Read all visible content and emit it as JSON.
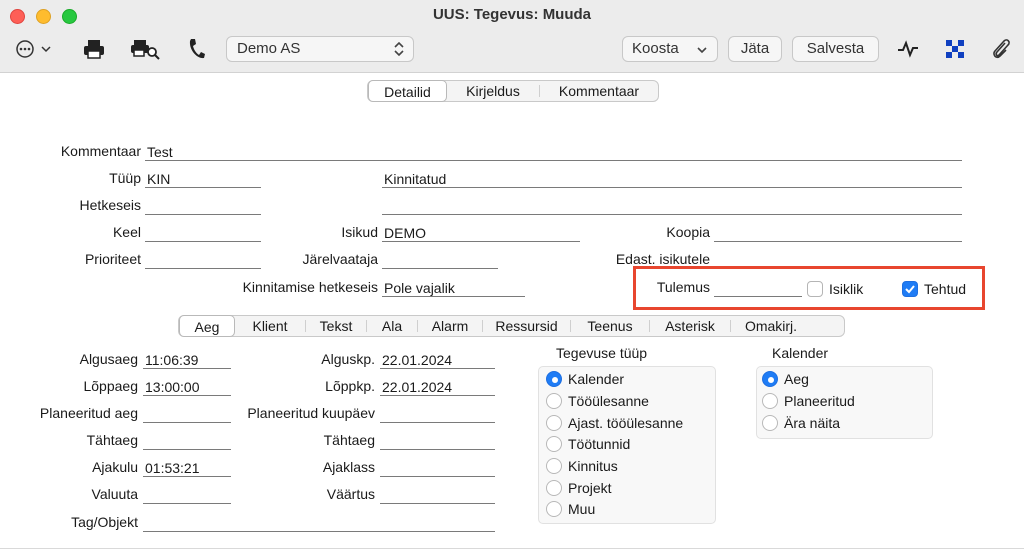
{
  "window": {
    "title": "UUS: Tegevus: Muuda"
  },
  "toolbar": {
    "company": "Demo AS",
    "koosta": "Koosta",
    "jata": "Jäta",
    "salvesta": "Salvesta"
  },
  "top_tabs": [
    "Detailid",
    "Kirjeldus",
    "Kommentaar"
  ],
  "header_fields": {
    "kommentaar_label": "Kommentaar",
    "kommentaar_value": "Test",
    "tyyp_label": "Tüüp",
    "tyyp_value": "KIN",
    "tyyp_desc": "Kinnitatud",
    "hetkeseis_label": "Hetkeseis",
    "hetkeseis_value": "",
    "hetkeseis_desc": "",
    "keel_label": "Keel",
    "keel_value": "",
    "isikud_label": "Isikud",
    "isikud_value": "DEMO",
    "koopia_label": "Koopia",
    "koopia_value": "",
    "prioriteet_label": "Prioriteet",
    "prioriteet_value": "",
    "jarelvaataja_label": "Järelvaataja",
    "jarelvaataja_value": "",
    "edast_label": "Edast. isikutele",
    "kinnitamise_label": "Kinnitamise hetkeseis",
    "kinnitamise_value": "Pole vajalik",
    "tulemus_label": "Tulemus",
    "tulemus_value": "",
    "isiklik_label": "Isiklik",
    "isiklik_checked": false,
    "tehtud_label": "Tehtud",
    "tehtud_checked": true
  },
  "sub_tabs": [
    "Aeg",
    "Klient",
    "Tekst",
    "Ala",
    "Alarm",
    "Ressursid",
    "Teenus",
    "Asterisk",
    "Omakirj."
  ],
  "time_fields": {
    "algusaeg_label": "Algusaeg",
    "algusaeg_value": "11:06:39",
    "loppaeg_label": "Lõppaeg",
    "loppaeg_value": "13:00:00",
    "planeeritud_aeg_label": "Planeeritud aeg",
    "planeeritud_aeg_value": "",
    "tahtaeg_label": "Tähtaeg",
    "tahtaeg_value": "",
    "ajakulu_label": "Ajakulu",
    "ajakulu_value": "01:53:21",
    "valuuta_label": "Valuuta",
    "valuuta_value": "",
    "tag_label": "Tag/Objekt",
    "tag_value": "",
    "alguskp_label": "Alguskp.",
    "alguskp_value": "22.01.2024",
    "loppkp_label": "Lõppkp.",
    "loppkp_value": "22.01.2024",
    "planeeritud_kp_label": "Planeeritud kuupäev",
    "planeeritud_kp_value": "",
    "tahtaeg2_label": "Tähtaeg",
    "tahtaeg2_value": "",
    "ajaklass_label": "Ajaklass",
    "ajaklass_value": "",
    "vaartus_label": "Väärtus",
    "vaartus_value": ""
  },
  "tegevuse_tyyp": {
    "title": "Tegevuse tüüp",
    "options": [
      "Kalender",
      "Tööülesanne",
      "Ajast. tööülesanne",
      "Töötunnid",
      "Kinnitus",
      "Projekt",
      "Muu"
    ],
    "selected": "Kalender"
  },
  "kalender": {
    "title": "Kalender",
    "options": [
      "Aeg",
      "Planeeritud",
      "Ära näita"
    ],
    "selected": "Aeg"
  }
}
